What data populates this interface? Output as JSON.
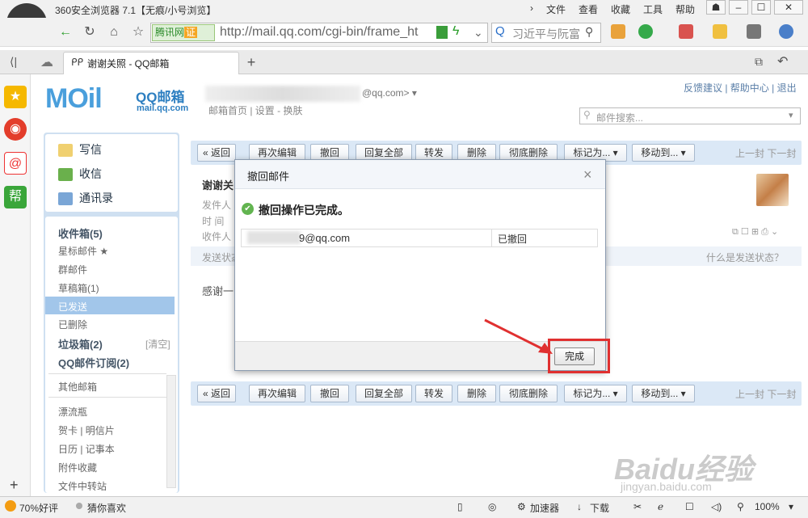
{
  "browser": {
    "title": "360安全浏览器 7.1【无痕/小号浏览】",
    "menu": [
      "文件",
      "查看",
      "收藏",
      "工具",
      "帮助"
    ],
    "cert_label": "腾讯网",
    "cert_badge": "证",
    "url": "http://mail.qq.com/cgi-bin/frame_ht",
    "search_text": "习近平与阮富",
    "tab_label": "谢谢关照 - QQ邮箱",
    "tab_add": "+",
    "icons": [
      "back-icon",
      "refresh-icon",
      "home-icon",
      "star-icon",
      "lightning-icon",
      "search-icon"
    ]
  },
  "app_sidebar": {
    "weibo_label": "帮",
    "add": "+"
  },
  "mail": {
    "logo_m": "MOil",
    "logo_qq": "QQ邮箱",
    "logo_domain": "mail.qq.com",
    "account_suffix": "@qq.com> ▾",
    "account_links": "邮箱首页 | 设置 - 换肤",
    "top_links": "反馈建议 | 帮助中心 | 退出",
    "search_placeholder": "邮件搜索...",
    "commands": [
      "写信",
      "收信",
      "通讯录"
    ],
    "folders": [
      {
        "label": "收件箱(5)",
        "bold": true
      },
      {
        "label": "星标邮件 ★",
        "bold": false
      },
      {
        "label": "群邮件",
        "bold": false
      },
      {
        "label": "草稿箱(1)",
        "bold": false
      },
      {
        "label": "已发送",
        "bold": false,
        "selected": true
      },
      {
        "label": "已删除",
        "bold": false
      },
      {
        "label": "垃圾箱(2)",
        "bold": true
      },
      {
        "label": "QQ邮件订阅(2)",
        "bold": true
      },
      {
        "label": "其他邮箱",
        "bold": false
      },
      {
        "label": "漂流瓶",
        "bold": false
      },
      {
        "label": "贺卡 | 明信片",
        "bold": false
      },
      {
        "label": "日历 | 记事本",
        "bold": false
      },
      {
        "label": "附件收藏",
        "bold": false
      },
      {
        "label": "文件中转站",
        "bold": false
      }
    ],
    "clear_label": "[清空]",
    "toolbar": [
      "« 返回",
      "再次编辑",
      "撤回",
      "回复全部",
      "转发",
      "删除",
      "彻底删除",
      "标记为... ▾",
      "移动到... ▾"
    ],
    "prev_next": "上一封  下一封",
    "subject": "谢谢关",
    "meta": [
      "发件人",
      "时  间",
      "收件人"
    ],
    "status_label": "发送状态",
    "status_help": "什么是发送状态？",
    "body": "感谢一"
  },
  "dialog": {
    "title": "撤回邮件",
    "close": "×",
    "message": "撤回操作已完成。",
    "address": "9@qq.com",
    "state": "已撤回",
    "done_button": "完成"
  },
  "statusbar": {
    "rating": "70%好评",
    "guess": "猜你喜欢",
    "accelerator": "加速器",
    "download": "下载",
    "zoom": "100%"
  },
  "watermark": {
    "brand": "Baidu经验",
    "site": "jingyan.baidu.com"
  }
}
